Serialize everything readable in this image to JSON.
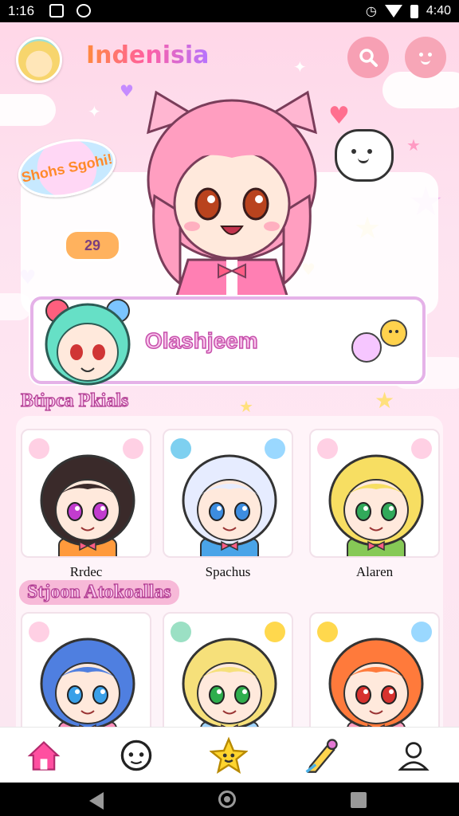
{
  "status_bar": {
    "time": "1:16",
    "right_text": "4:40",
    "icons": [
      "gallery-icon",
      "app-icon",
      "alarm-icon",
      "wifi-icon",
      "battery-icon"
    ]
  },
  "header": {
    "title": "Indenisia",
    "search_icon": "search-icon",
    "profile_icon": "smiley-face-icon"
  },
  "stickers": {
    "badge_text": "Shohs Sgohi!",
    "number_badge": "29"
  },
  "featured": {
    "label": "Olashjeem"
  },
  "sections": [
    {
      "title": "Btipca Pkials",
      "cards": [
        {
          "name": "Rrdec",
          "hair": "#3a2a2a",
          "eye": "#c23ccf",
          "shirt": "#ff9a3c"
        },
        {
          "name": "Spachus",
          "hair": "#e6ecff",
          "eye": "#3d8de0",
          "shirt": "#4aa4e8"
        },
        {
          "name": "Alaren",
          "hair": "#f7de62",
          "eye": "#31a95a",
          "shirt": "#86c956"
        }
      ]
    },
    {
      "title": "Stjoon Atokoallas",
      "cards": [
        {
          "name": "",
          "hair": "#4f7fe0",
          "eye": "#3aa0e8",
          "shirt": "#ff8dbb"
        },
        {
          "name": "",
          "hair": "#f6e07a",
          "eye": "#2fae4d",
          "shirt": "#9fd4ff"
        },
        {
          "name": "",
          "hair": "#ff7a3b",
          "eye": "#d7322f",
          "shirt": "#ff9ec0"
        }
      ]
    }
  ],
  "bottom_nav": [
    {
      "icon": "home-icon",
      "active": true
    },
    {
      "icon": "chat-face-icon",
      "active": false
    },
    {
      "icon": "star-face-icon",
      "active": false
    },
    {
      "icon": "pencil-icon",
      "active": false
    },
    {
      "icon": "user-icon",
      "active": false
    }
  ],
  "colors": {
    "accent_pink": "#ff5fa2",
    "card_border": "#e5b2e8",
    "background": "#ffd7e8"
  }
}
